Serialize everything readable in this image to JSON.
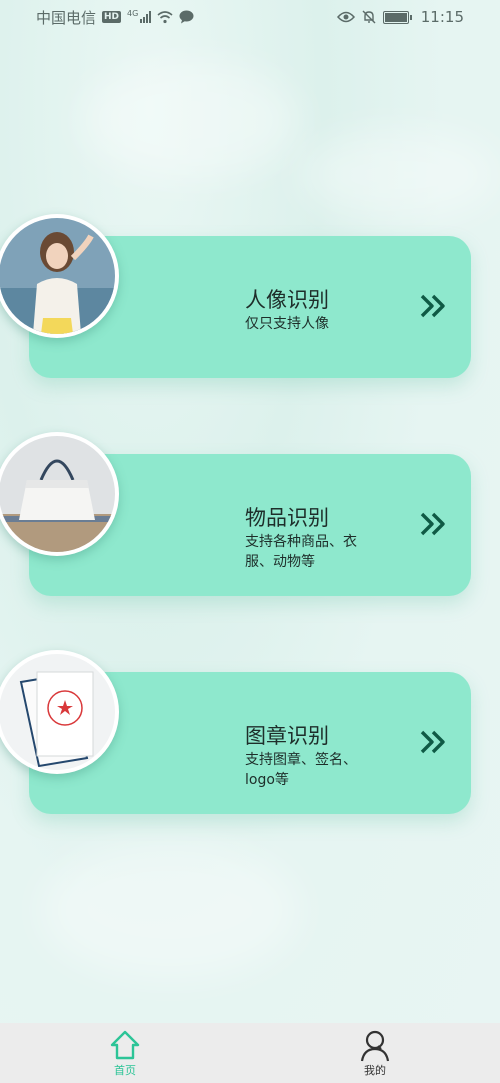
{
  "status_bar": {
    "carrier": "中国电信",
    "hd_badge": "HD",
    "network": "4G",
    "time": "11:15"
  },
  "cards": [
    {
      "title": "人像识别",
      "subtitle": "仅只支持人像",
      "icon": "portrait-photo"
    },
    {
      "title": "物品识别",
      "subtitle": "支持各种商品、衣服、动物等",
      "icon": "handbag-photo"
    },
    {
      "title": "图章识别",
      "subtitle": "支持图章、签名、logo等",
      "icon": "stamp-document-photo"
    }
  ],
  "bottom_nav": {
    "items": [
      {
        "label": "首页",
        "icon": "home-icon",
        "active": true
      },
      {
        "label": "我的",
        "icon": "user-icon",
        "active": false
      }
    ]
  },
  "colors": {
    "card": "#8ee8cd",
    "accent": "#2cc497",
    "arrow": "#0f5a45"
  }
}
